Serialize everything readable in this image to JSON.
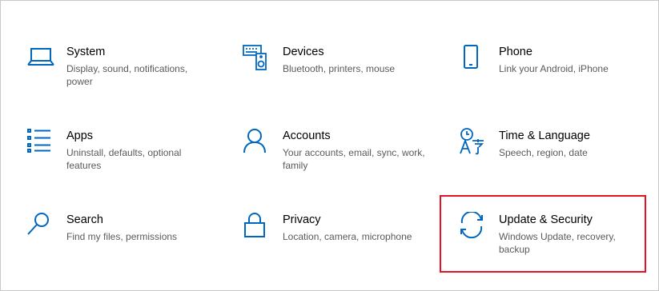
{
  "colors": {
    "accent": "#0067c0",
    "highlight": "#e81123"
  },
  "tiles": [
    {
      "title": "System",
      "desc": "Display, sound, notifications, power",
      "icon": "laptop-icon"
    },
    {
      "title": "Devices",
      "desc": "Bluetooth, printers, mouse",
      "icon": "keyboard-speaker-icon"
    },
    {
      "title": "Phone",
      "desc": "Link your Android, iPhone",
      "icon": "phone-icon"
    },
    {
      "title": "Apps",
      "desc": "Uninstall, defaults, optional features",
      "icon": "apps-list-icon"
    },
    {
      "title": "Accounts",
      "desc": "Your accounts, email, sync, work, family",
      "icon": "person-icon"
    },
    {
      "title": "Time & Language",
      "desc": "Speech, region, date",
      "icon": "time-language-icon"
    },
    {
      "title": "Search",
      "desc": "Find my files, permissions",
      "icon": "search-icon"
    },
    {
      "title": "Privacy",
      "desc": "Location, camera, microphone",
      "icon": "lock-icon"
    },
    {
      "title": "Update & Security",
      "desc": "Windows Update, recovery, backup",
      "icon": "sync-icon"
    }
  ]
}
